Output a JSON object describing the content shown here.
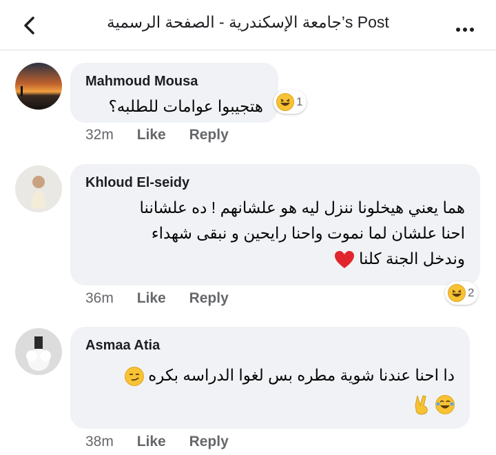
{
  "header": {
    "title": "جامعة الإسكندرية - الصفحة الرسمية‎’s Post",
    "back_icon": "chevron-left-icon",
    "more_icon": "more-dots-icon"
  },
  "comments": [
    {
      "author": "Mahmoud Mousa",
      "text": "هتجيبوا عوامات للطلبه؟",
      "time": "32m",
      "like_label": "Like",
      "reply_label": "Reply",
      "reaction": {
        "icon": "laughing-emoji-icon",
        "count": "1"
      }
    },
    {
      "author": "Khloud El-seidy",
      "lines": [
        "هما يعني هيخلونا ننزل ليه هو علشانهم ! ده علشاننا",
        "احنا علشان لما نموت واحنا رايحين و نبقى شهداء",
        "وندخل الجنة كلنا"
      ],
      "inline_emoji": "red-heart-emoji-icon",
      "time": "36m",
      "like_label": "Like",
      "reply_label": "Reply",
      "reaction": {
        "icon": "laughing-emoji-icon",
        "count": "2"
      }
    },
    {
      "author": "Asmaa Atia",
      "text": "دا احنا عندنا شوية مطره بس لغوا الدراسه بكره",
      "inline_emoji": "smirk-emoji-icon",
      "second_line_emojis": [
        "tears-of-joy-emoji-icon",
        "victory-hand-emoji-icon"
      ],
      "time": "38m",
      "like_label": "Like",
      "reply_label": "Reply"
    }
  ],
  "colors": {
    "bubble": "#f0f2f5",
    "meta_text": "#65676b",
    "emoji_yellow": "#f7c234",
    "heart_red": "#e0262c"
  }
}
